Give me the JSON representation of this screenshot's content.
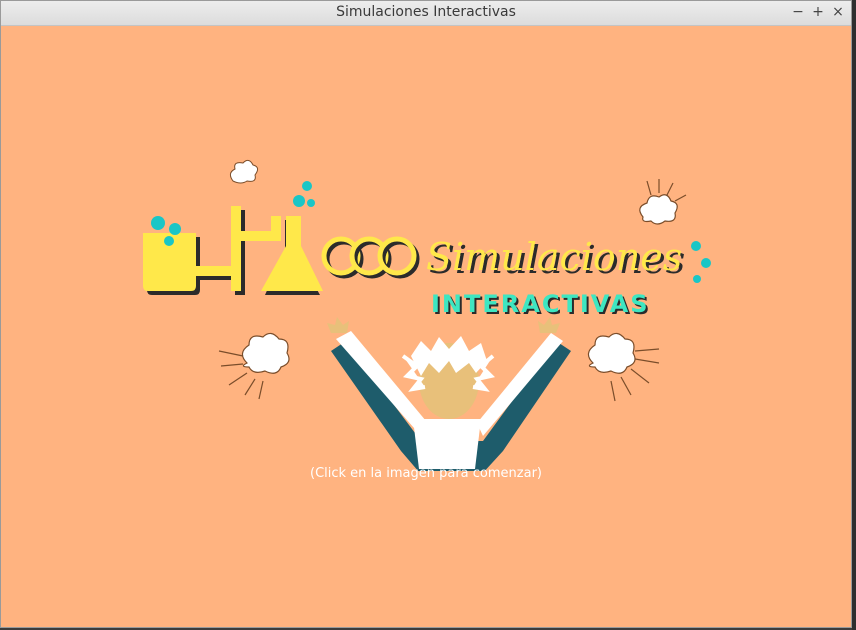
{
  "window": {
    "title": "Simulaciones Interactivas",
    "controls": {
      "minimize": "−",
      "maximize": "+",
      "close": "×"
    }
  },
  "splash": {
    "logo_line1": "Simulaciones",
    "logo_line2": "INTERACTIVAS",
    "caption": "(Click en la imagen para comenzar)"
  },
  "colors": {
    "background": "#ffb380",
    "logo_yellow": "#ffe84a",
    "logo_teal": "#3ee6c1",
    "bubble_cyan": "#19c6c6",
    "coat_dark": "#1e5c6b",
    "skin": "#e8c07a"
  }
}
